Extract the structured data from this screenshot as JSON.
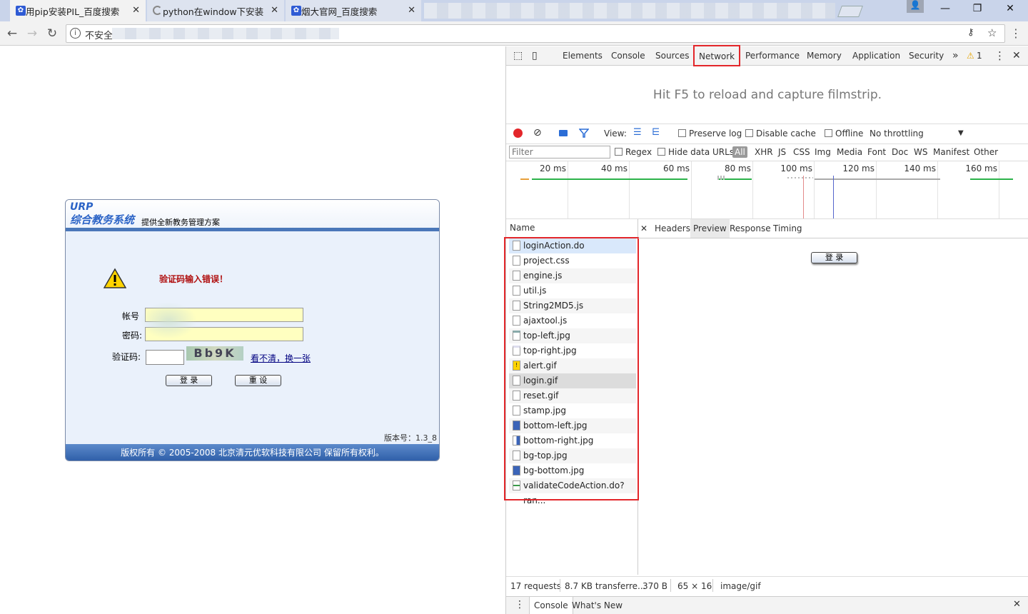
{
  "browser": {
    "tabs": [
      {
        "title": "用pip安装PIL_百度搜索",
        "icon": "baidu-paw-icon"
      },
      {
        "title": "python在window下安装",
        "icon": "loading-spinner-icon"
      },
      {
        "title": "烟大官网_百度搜索",
        "icon": "baidu-paw-icon"
      }
    ],
    "address": {
      "security_label": "不安全"
    }
  },
  "page": {
    "logo_top": "URP",
    "logo_main": "综合教务系统",
    "logo_slogan": "提供全新教务管理方案",
    "error_message": "验证码输入错误！",
    "account_label": "帐号",
    "password_label": "密码:",
    "captcha_label": "验证码:",
    "captcha_text": "Bb9K",
    "refresh_captcha_link": "看不清，换一张",
    "login_button": "登 录",
    "reset_button": "重 设",
    "version": "版本号：1.3_8",
    "copyright": "版权所有 © 2005-2008 北京清元优软科技有限公司 保留所有权利。"
  },
  "devtools": {
    "tabs": [
      "Elements",
      "Console",
      "Sources",
      "Network",
      "Performance",
      "Memory",
      "Application",
      "Security"
    ],
    "selected_tab": "Network",
    "more_tabs": "»",
    "warning_count": "1",
    "filmstrip_hint": "Hit F5 to reload and capture filmstrip.",
    "view_label": "View:",
    "preserve_log": "Preserve log",
    "disable_cache": "Disable cache",
    "offline": "Offline",
    "throttling": "No throttling",
    "filter_placeholder": "Filter",
    "regex": "Regex",
    "hide_data_urls": "Hide data URLs",
    "type_filters": [
      "All",
      "XHR",
      "JS",
      "CSS",
      "Img",
      "Media",
      "Font",
      "Doc",
      "WS",
      "Manifest",
      "Other"
    ],
    "timeline_ticks": [
      "20 ms",
      "40 ms",
      "60 ms",
      "80 ms",
      "100 ms",
      "120 ms",
      "140 ms",
      "160 ms"
    ],
    "name_header": "Name",
    "requests": [
      {
        "name": "loginAction.do",
        "icon": "document-icon"
      },
      {
        "name": "project.css",
        "icon": "document-icon"
      },
      {
        "name": "engine.js",
        "icon": "document-icon"
      },
      {
        "name": "util.js",
        "icon": "document-icon"
      },
      {
        "name": "String2MD5.js",
        "icon": "document-icon"
      },
      {
        "name": "ajaxtool.js",
        "icon": "document-icon"
      },
      {
        "name": "top-left.jpg",
        "icon": "image-icon"
      },
      {
        "name": "top-right.jpg",
        "icon": "image-icon"
      },
      {
        "name": "alert.gif",
        "icon": "warning-image-icon"
      },
      {
        "name": "login.gif",
        "icon": "image-icon"
      },
      {
        "name": "reset.gif",
        "icon": "image-icon"
      },
      {
        "name": "stamp.jpg",
        "icon": "image-icon"
      },
      {
        "name": "bottom-left.jpg",
        "icon": "blue-image-icon"
      },
      {
        "name": "bottom-right.jpg",
        "icon": "blue-image-icon"
      },
      {
        "name": "bg-top.jpg",
        "icon": "image-icon"
      },
      {
        "name": "bg-bottom.jpg",
        "icon": "blue-image-icon"
      },
      {
        "name": "validateCodeAction.do?ran...",
        "icon": "green-image-icon"
      }
    ],
    "preview_tabs": [
      "Headers",
      "Preview",
      "Response",
      "Timing"
    ],
    "selected_preview_tab": "Preview",
    "preview_button": "登 录",
    "status": {
      "requests": "17 requests",
      "transferred": "8.7 KB transferre...",
      "size": "370 B",
      "dimensions": "65 × 16",
      "mime": "image/gif"
    },
    "drawer_tabs": [
      "Console",
      "What's New"
    ]
  }
}
